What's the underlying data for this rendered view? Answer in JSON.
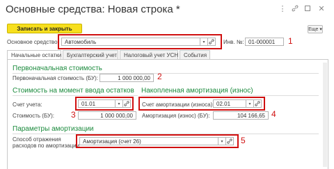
{
  "window": {
    "title": "Основные средства: Новая строка *"
  },
  "toolbar": {
    "save_label": "Записать и закрыть",
    "more_label": "Еще ▾"
  },
  "header": {
    "asset_label": "Основное средство:",
    "asset_value": "Автомобиль",
    "inv_label": "Инв. №:",
    "inv_value": "01-000001"
  },
  "tabs": [
    "Начальные остатки",
    "Бухгалтерский учет",
    "Налоговый учет УСН",
    "События"
  ],
  "sections": {
    "initial_cost": {
      "title": "Первоначальная стоимость",
      "label": "Первоначальная стоимость (БУ):",
      "value": "1 000 000,00"
    },
    "cost_at_entry": {
      "title": "Стоимость на момент ввода остатков",
      "account_label": "Счет учета:",
      "account_value": "01.01",
      "cost_label": "Стоимость (БУ):",
      "cost_value": "1 000 000,00"
    },
    "accumulated": {
      "title": "Накопленная амортизация (износ)",
      "account_label": "Счет амортизации (износа):",
      "account_value": "02.01",
      "amount_label": "Амортизация (износ) (БУ):",
      "amount_value": "104 166,65"
    },
    "params": {
      "title": "Параметры амортизации",
      "method_label_1": "Способ отражения",
      "method_label_2": "расходов по амортизации:",
      "method_value": "Амортизация (счет 26)"
    }
  },
  "annotations": [
    "1",
    "2",
    "3",
    "4",
    "5"
  ],
  "colors": {
    "accent_yellow": "#f7df1e",
    "section_green": "#1a8a3c",
    "annotation_red": "#d01010"
  }
}
